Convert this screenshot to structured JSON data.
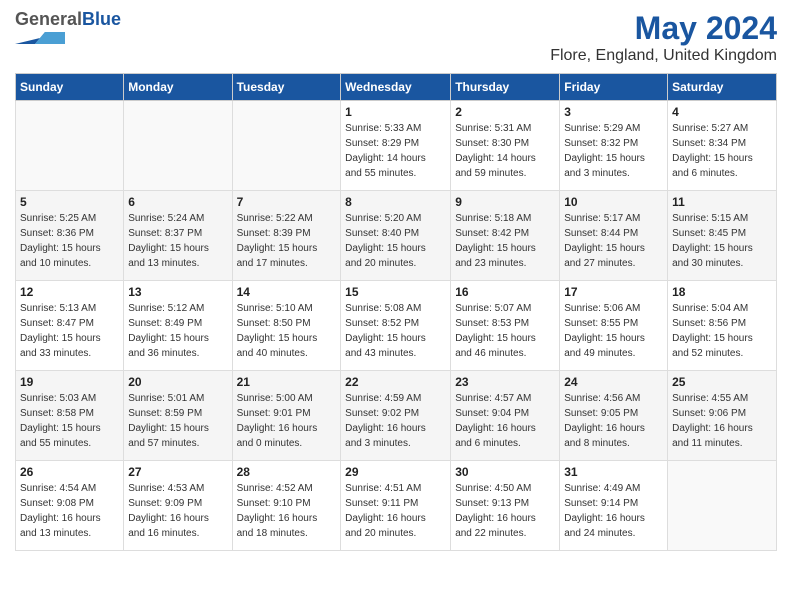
{
  "header": {
    "logo_general": "General",
    "logo_blue": "Blue",
    "month_year": "May 2024",
    "location": "Flore, England, United Kingdom"
  },
  "days_of_week": [
    "Sunday",
    "Monday",
    "Tuesday",
    "Wednesday",
    "Thursday",
    "Friday",
    "Saturday"
  ],
  "weeks": [
    [
      {
        "day": "",
        "info": ""
      },
      {
        "day": "",
        "info": ""
      },
      {
        "day": "",
        "info": ""
      },
      {
        "day": "1",
        "info": "Sunrise: 5:33 AM\nSunset: 8:29 PM\nDaylight: 14 hours\nand 55 minutes."
      },
      {
        "day": "2",
        "info": "Sunrise: 5:31 AM\nSunset: 8:30 PM\nDaylight: 14 hours\nand 59 minutes."
      },
      {
        "day": "3",
        "info": "Sunrise: 5:29 AM\nSunset: 8:32 PM\nDaylight: 15 hours\nand 3 minutes."
      },
      {
        "day": "4",
        "info": "Sunrise: 5:27 AM\nSunset: 8:34 PM\nDaylight: 15 hours\nand 6 minutes."
      }
    ],
    [
      {
        "day": "5",
        "info": "Sunrise: 5:25 AM\nSunset: 8:36 PM\nDaylight: 15 hours\nand 10 minutes."
      },
      {
        "day": "6",
        "info": "Sunrise: 5:24 AM\nSunset: 8:37 PM\nDaylight: 15 hours\nand 13 minutes."
      },
      {
        "day": "7",
        "info": "Sunrise: 5:22 AM\nSunset: 8:39 PM\nDaylight: 15 hours\nand 17 minutes."
      },
      {
        "day": "8",
        "info": "Sunrise: 5:20 AM\nSunset: 8:40 PM\nDaylight: 15 hours\nand 20 minutes."
      },
      {
        "day": "9",
        "info": "Sunrise: 5:18 AM\nSunset: 8:42 PM\nDaylight: 15 hours\nand 23 minutes."
      },
      {
        "day": "10",
        "info": "Sunrise: 5:17 AM\nSunset: 8:44 PM\nDaylight: 15 hours\nand 27 minutes."
      },
      {
        "day": "11",
        "info": "Sunrise: 5:15 AM\nSunset: 8:45 PM\nDaylight: 15 hours\nand 30 minutes."
      }
    ],
    [
      {
        "day": "12",
        "info": "Sunrise: 5:13 AM\nSunset: 8:47 PM\nDaylight: 15 hours\nand 33 minutes."
      },
      {
        "day": "13",
        "info": "Sunrise: 5:12 AM\nSunset: 8:49 PM\nDaylight: 15 hours\nand 36 minutes."
      },
      {
        "day": "14",
        "info": "Sunrise: 5:10 AM\nSunset: 8:50 PM\nDaylight: 15 hours\nand 40 minutes."
      },
      {
        "day": "15",
        "info": "Sunrise: 5:08 AM\nSunset: 8:52 PM\nDaylight: 15 hours\nand 43 minutes."
      },
      {
        "day": "16",
        "info": "Sunrise: 5:07 AM\nSunset: 8:53 PM\nDaylight: 15 hours\nand 46 minutes."
      },
      {
        "day": "17",
        "info": "Sunrise: 5:06 AM\nSunset: 8:55 PM\nDaylight: 15 hours\nand 49 minutes."
      },
      {
        "day": "18",
        "info": "Sunrise: 5:04 AM\nSunset: 8:56 PM\nDaylight: 15 hours\nand 52 minutes."
      }
    ],
    [
      {
        "day": "19",
        "info": "Sunrise: 5:03 AM\nSunset: 8:58 PM\nDaylight: 15 hours\nand 55 minutes."
      },
      {
        "day": "20",
        "info": "Sunrise: 5:01 AM\nSunset: 8:59 PM\nDaylight: 15 hours\nand 57 minutes."
      },
      {
        "day": "21",
        "info": "Sunrise: 5:00 AM\nSunset: 9:01 PM\nDaylight: 16 hours\nand 0 minutes."
      },
      {
        "day": "22",
        "info": "Sunrise: 4:59 AM\nSunset: 9:02 PM\nDaylight: 16 hours\nand 3 minutes."
      },
      {
        "day": "23",
        "info": "Sunrise: 4:57 AM\nSunset: 9:04 PM\nDaylight: 16 hours\nand 6 minutes."
      },
      {
        "day": "24",
        "info": "Sunrise: 4:56 AM\nSunset: 9:05 PM\nDaylight: 16 hours\nand 8 minutes."
      },
      {
        "day": "25",
        "info": "Sunrise: 4:55 AM\nSunset: 9:06 PM\nDaylight: 16 hours\nand 11 minutes."
      }
    ],
    [
      {
        "day": "26",
        "info": "Sunrise: 4:54 AM\nSunset: 9:08 PM\nDaylight: 16 hours\nand 13 minutes."
      },
      {
        "day": "27",
        "info": "Sunrise: 4:53 AM\nSunset: 9:09 PM\nDaylight: 16 hours\nand 16 minutes."
      },
      {
        "day": "28",
        "info": "Sunrise: 4:52 AM\nSunset: 9:10 PM\nDaylight: 16 hours\nand 18 minutes."
      },
      {
        "day": "29",
        "info": "Sunrise: 4:51 AM\nSunset: 9:11 PM\nDaylight: 16 hours\nand 20 minutes."
      },
      {
        "day": "30",
        "info": "Sunrise: 4:50 AM\nSunset: 9:13 PM\nDaylight: 16 hours\nand 22 minutes."
      },
      {
        "day": "31",
        "info": "Sunrise: 4:49 AM\nSunset: 9:14 PM\nDaylight: 16 hours\nand 24 minutes."
      },
      {
        "day": "",
        "info": ""
      }
    ]
  ]
}
